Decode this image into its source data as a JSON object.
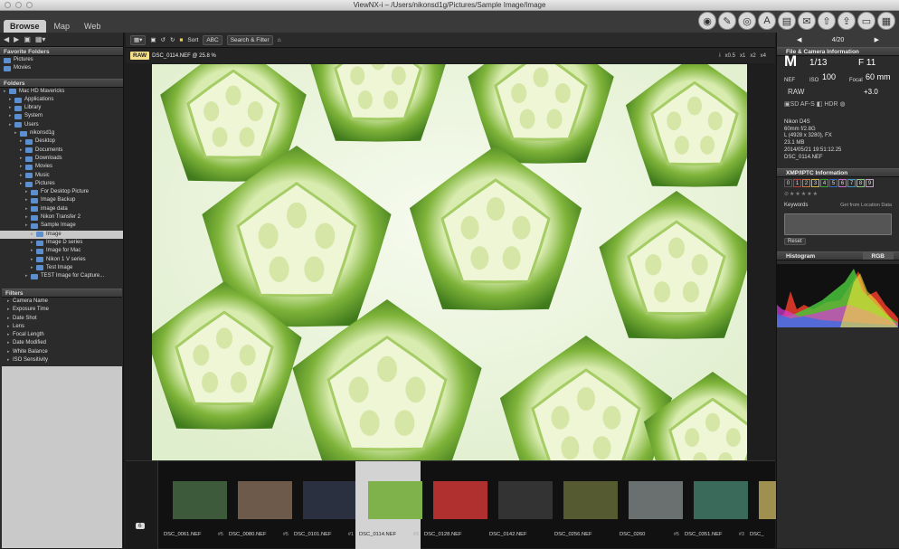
{
  "window": {
    "title": "ViewNX-i – /Users/nikonsd1g/Pictures/Sample Image/Image"
  },
  "modes": [
    {
      "label": "Browse"
    },
    {
      "label": "Map"
    },
    {
      "label": "Web"
    }
  ],
  "top_icons": [
    "camera-icon",
    "edit-icon",
    "movie-icon",
    "app-icon",
    "print-icon",
    "mail-icon",
    "upload-icon",
    "export-icon",
    "display-icon",
    "layout-icon"
  ],
  "left": {
    "favorites_title": "Favorite Folders",
    "favorites": [
      {
        "label": "Pictures"
      },
      {
        "label": "Movies"
      }
    ],
    "folders_title": "Folders",
    "folders": [
      {
        "label": "Mac HD Mavericks",
        "level": 0
      },
      {
        "label": "Applications",
        "level": 1
      },
      {
        "label": "Library",
        "level": 1
      },
      {
        "label": "System",
        "level": 1
      },
      {
        "label": "Users",
        "level": 1
      },
      {
        "label": "nikonsd1g",
        "level": 2
      },
      {
        "label": "Desktop",
        "level": 3
      },
      {
        "label": "Documents",
        "level": 3
      },
      {
        "label": "Downloads",
        "level": 3
      },
      {
        "label": "Movies",
        "level": 3
      },
      {
        "label": "Music",
        "level": 3
      },
      {
        "label": "Pictures",
        "level": 3
      },
      {
        "label": "For Desktop Picture",
        "level": 4
      },
      {
        "label": "Image Backup",
        "level": 4
      },
      {
        "label": "image data",
        "level": 4
      },
      {
        "label": "Nikon Transfer 2",
        "level": 4
      },
      {
        "label": "Sample Image",
        "level": 4
      },
      {
        "label": "Image",
        "level": 5,
        "selected": true
      },
      {
        "label": "Image D series",
        "level": 5
      },
      {
        "label": "Image for Mac",
        "level": 5
      },
      {
        "label": "Nikon 1 V series",
        "level": 5
      },
      {
        "label": "Test Image",
        "level": 5
      },
      {
        "label": "TEST Image for Capture...",
        "level": 4
      }
    ],
    "filters_title": "Filters",
    "filters": [
      {
        "label": "Camera Name"
      },
      {
        "label": "Exposure Time"
      },
      {
        "label": "Date Shot"
      },
      {
        "label": "Lens"
      },
      {
        "label": "Focal Length"
      },
      {
        "label": "Date Modified"
      },
      {
        "label": "White Balance"
      },
      {
        "label": "ISO Sensitivity"
      }
    ]
  },
  "toolbar": {
    "sort": "Sort",
    "abc": "ABC",
    "search": "Search & Filter"
  },
  "subbar": {
    "raw": "RAW",
    "filename": "DSC_0114.NEF @ 25.8 %",
    "zooms": [
      "x0.5",
      "x1",
      "x2",
      "x4"
    ]
  },
  "filmstrip": {
    "count": "6",
    "items": [
      {
        "name": "DSC_0061.NEF",
        "num": "#5",
        "color": "#3d5a3a"
      },
      {
        "name": "DSC_0080.NEF",
        "num": "#5",
        "color": "#6e5a4a"
      },
      {
        "name": "DSC_0101.NEF",
        "num": "#1",
        "color": "#2a3040"
      },
      {
        "name": "DSC_0114.NEF",
        "num": "#3",
        "color": "#7fb24a",
        "selected": true
      },
      {
        "name": "DSC_0128.NEF",
        "num": "",
        "color": "#b03030"
      },
      {
        "name": "DSC_0142.NEF",
        "num": "",
        "color": "#333"
      },
      {
        "name": "DSC_0256.NEF",
        "num": "",
        "color": "#555a30"
      },
      {
        "name": "DSC_0260",
        "num": "#5",
        "color": "#6a7070"
      },
      {
        "name": "DSC_0351.NEF",
        "num": "#3",
        "color": "#3a6a5a"
      },
      {
        "name": "DSC_",
        "num": "",
        "color": "#a09050"
      }
    ]
  },
  "right": {
    "pager": "4/20",
    "file_info_title": "File & Camera Information",
    "mode": "M",
    "shutter": "1/13",
    "aperture": "F 11",
    "format": "NEF",
    "iso_label": "ISO",
    "iso": "100",
    "focal_label": "Focal",
    "focal": "60 mm",
    "raw": "RAW",
    "ev": "+3.0",
    "lines": [
      "Nikon D4S",
      "60mm f/2.8G",
      "L (4928 x 3280), FX",
      "23.1 MB",
      "2014/05/21 19:51:12.25",
      "DSC_0114.NEF"
    ],
    "xmp_title": "XMP/IPTC Information",
    "labels": [
      "0",
      "1",
      "2",
      "3",
      "4",
      "5",
      "6",
      "7",
      "8",
      "9"
    ],
    "keywords": "Keywords",
    "location_btn": "Get from Location Data",
    "reset": "Reset",
    "histogram_title": "Histogram",
    "histogram_mode": "RGB"
  }
}
